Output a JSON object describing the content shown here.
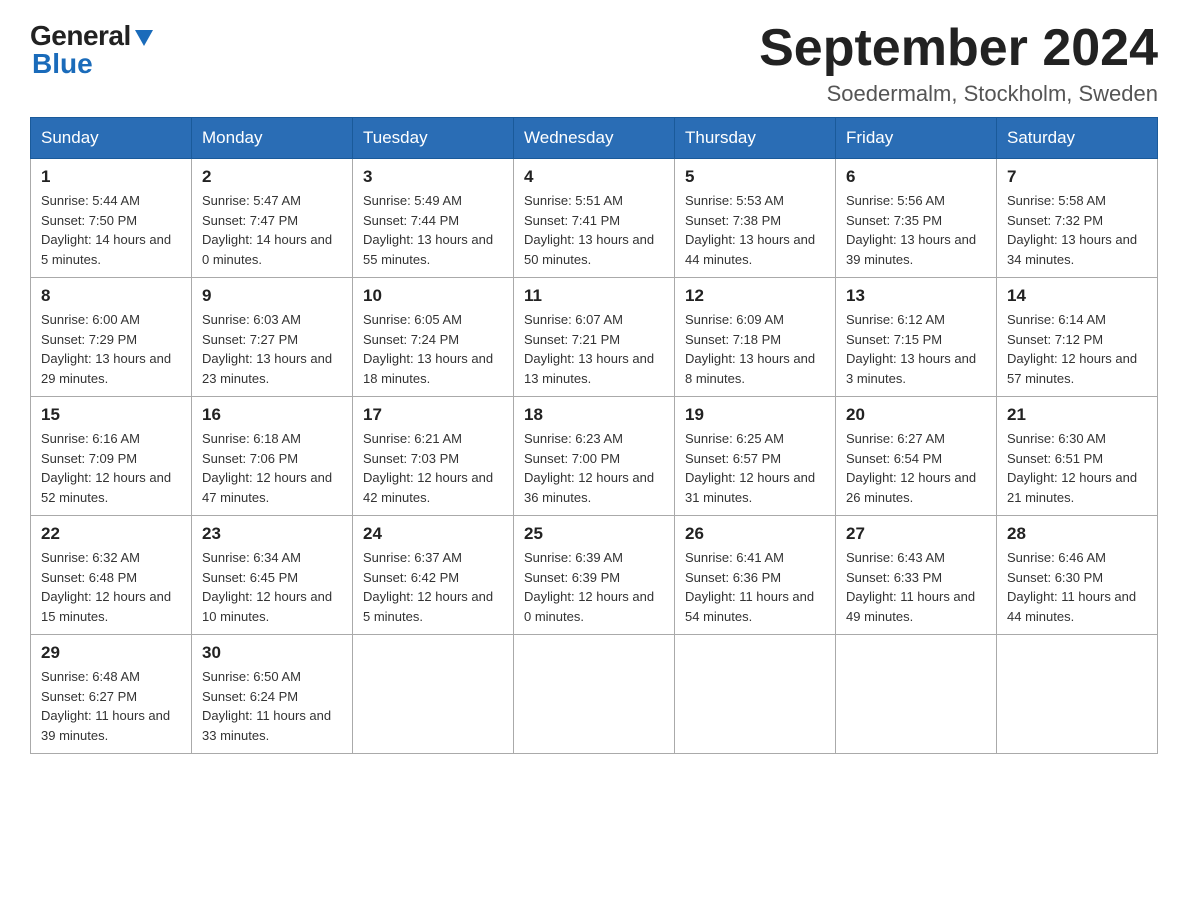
{
  "header": {
    "logo_line1": "General",
    "logo_line2": "Blue",
    "month_title": "September 2024",
    "location": "Soedermalm, Stockholm, Sweden"
  },
  "weekdays": [
    "Sunday",
    "Monday",
    "Tuesday",
    "Wednesday",
    "Thursday",
    "Friday",
    "Saturday"
  ],
  "weeks": [
    [
      {
        "day": 1,
        "sunrise": "5:44 AM",
        "sunset": "7:50 PM",
        "daylight": "14 hours and 5 minutes."
      },
      {
        "day": 2,
        "sunrise": "5:47 AM",
        "sunset": "7:47 PM",
        "daylight": "14 hours and 0 minutes."
      },
      {
        "day": 3,
        "sunrise": "5:49 AM",
        "sunset": "7:44 PM",
        "daylight": "13 hours and 55 minutes."
      },
      {
        "day": 4,
        "sunrise": "5:51 AM",
        "sunset": "7:41 PM",
        "daylight": "13 hours and 50 minutes."
      },
      {
        "day": 5,
        "sunrise": "5:53 AM",
        "sunset": "7:38 PM",
        "daylight": "13 hours and 44 minutes."
      },
      {
        "day": 6,
        "sunrise": "5:56 AM",
        "sunset": "7:35 PM",
        "daylight": "13 hours and 39 minutes."
      },
      {
        "day": 7,
        "sunrise": "5:58 AM",
        "sunset": "7:32 PM",
        "daylight": "13 hours and 34 minutes."
      }
    ],
    [
      {
        "day": 8,
        "sunrise": "6:00 AM",
        "sunset": "7:29 PM",
        "daylight": "13 hours and 29 minutes."
      },
      {
        "day": 9,
        "sunrise": "6:03 AM",
        "sunset": "7:27 PM",
        "daylight": "13 hours and 23 minutes."
      },
      {
        "day": 10,
        "sunrise": "6:05 AM",
        "sunset": "7:24 PM",
        "daylight": "13 hours and 18 minutes."
      },
      {
        "day": 11,
        "sunrise": "6:07 AM",
        "sunset": "7:21 PM",
        "daylight": "13 hours and 13 minutes."
      },
      {
        "day": 12,
        "sunrise": "6:09 AM",
        "sunset": "7:18 PM",
        "daylight": "13 hours and 8 minutes."
      },
      {
        "day": 13,
        "sunrise": "6:12 AM",
        "sunset": "7:15 PM",
        "daylight": "13 hours and 3 minutes."
      },
      {
        "day": 14,
        "sunrise": "6:14 AM",
        "sunset": "7:12 PM",
        "daylight": "12 hours and 57 minutes."
      }
    ],
    [
      {
        "day": 15,
        "sunrise": "6:16 AM",
        "sunset": "7:09 PM",
        "daylight": "12 hours and 52 minutes."
      },
      {
        "day": 16,
        "sunrise": "6:18 AM",
        "sunset": "7:06 PM",
        "daylight": "12 hours and 47 minutes."
      },
      {
        "day": 17,
        "sunrise": "6:21 AM",
        "sunset": "7:03 PM",
        "daylight": "12 hours and 42 minutes."
      },
      {
        "day": 18,
        "sunrise": "6:23 AM",
        "sunset": "7:00 PM",
        "daylight": "12 hours and 36 minutes."
      },
      {
        "day": 19,
        "sunrise": "6:25 AM",
        "sunset": "6:57 PM",
        "daylight": "12 hours and 31 minutes."
      },
      {
        "day": 20,
        "sunrise": "6:27 AM",
        "sunset": "6:54 PM",
        "daylight": "12 hours and 26 minutes."
      },
      {
        "day": 21,
        "sunrise": "6:30 AM",
        "sunset": "6:51 PM",
        "daylight": "12 hours and 21 minutes."
      }
    ],
    [
      {
        "day": 22,
        "sunrise": "6:32 AM",
        "sunset": "6:48 PM",
        "daylight": "12 hours and 15 minutes."
      },
      {
        "day": 23,
        "sunrise": "6:34 AM",
        "sunset": "6:45 PM",
        "daylight": "12 hours and 10 minutes."
      },
      {
        "day": 24,
        "sunrise": "6:37 AM",
        "sunset": "6:42 PM",
        "daylight": "12 hours and 5 minutes."
      },
      {
        "day": 25,
        "sunrise": "6:39 AM",
        "sunset": "6:39 PM",
        "daylight": "12 hours and 0 minutes."
      },
      {
        "day": 26,
        "sunrise": "6:41 AM",
        "sunset": "6:36 PM",
        "daylight": "11 hours and 54 minutes."
      },
      {
        "day": 27,
        "sunrise": "6:43 AM",
        "sunset": "6:33 PM",
        "daylight": "11 hours and 49 minutes."
      },
      {
        "day": 28,
        "sunrise": "6:46 AM",
        "sunset": "6:30 PM",
        "daylight": "11 hours and 44 minutes."
      }
    ],
    [
      {
        "day": 29,
        "sunrise": "6:48 AM",
        "sunset": "6:27 PM",
        "daylight": "11 hours and 39 minutes."
      },
      {
        "day": 30,
        "sunrise": "6:50 AM",
        "sunset": "6:24 PM",
        "daylight": "11 hours and 33 minutes."
      },
      null,
      null,
      null,
      null,
      null
    ]
  ],
  "labels": {
    "sunrise": "Sunrise:",
    "sunset": "Sunset:",
    "daylight": "Daylight:"
  }
}
